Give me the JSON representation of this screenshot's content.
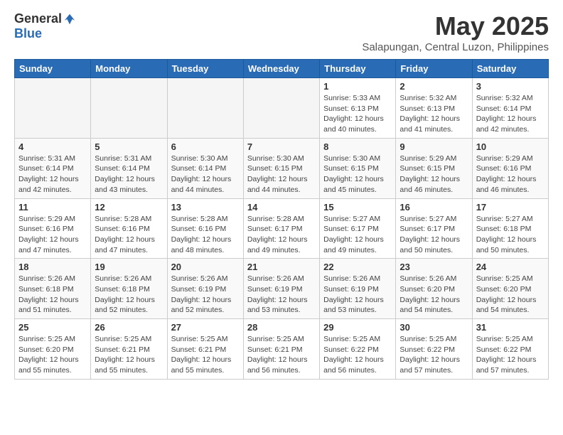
{
  "header": {
    "logo_general": "General",
    "logo_blue": "Blue",
    "title": "May 2025",
    "subtitle": "Salapungan, Central Luzon, Philippines"
  },
  "weekdays": [
    "Sunday",
    "Monday",
    "Tuesday",
    "Wednesday",
    "Thursday",
    "Friday",
    "Saturday"
  ],
  "weeks": [
    [
      {
        "day": "",
        "info": ""
      },
      {
        "day": "",
        "info": ""
      },
      {
        "day": "",
        "info": ""
      },
      {
        "day": "",
        "info": ""
      },
      {
        "day": "1",
        "info": "Sunrise: 5:33 AM\nSunset: 6:13 PM\nDaylight: 12 hours and 40 minutes."
      },
      {
        "day": "2",
        "info": "Sunrise: 5:32 AM\nSunset: 6:13 PM\nDaylight: 12 hours and 41 minutes."
      },
      {
        "day": "3",
        "info": "Sunrise: 5:32 AM\nSunset: 6:14 PM\nDaylight: 12 hours and 42 minutes."
      }
    ],
    [
      {
        "day": "4",
        "info": "Sunrise: 5:31 AM\nSunset: 6:14 PM\nDaylight: 12 hours and 42 minutes."
      },
      {
        "day": "5",
        "info": "Sunrise: 5:31 AM\nSunset: 6:14 PM\nDaylight: 12 hours and 43 minutes."
      },
      {
        "day": "6",
        "info": "Sunrise: 5:30 AM\nSunset: 6:14 PM\nDaylight: 12 hours and 44 minutes."
      },
      {
        "day": "7",
        "info": "Sunrise: 5:30 AM\nSunset: 6:15 PM\nDaylight: 12 hours and 44 minutes."
      },
      {
        "day": "8",
        "info": "Sunrise: 5:30 AM\nSunset: 6:15 PM\nDaylight: 12 hours and 45 minutes."
      },
      {
        "day": "9",
        "info": "Sunrise: 5:29 AM\nSunset: 6:15 PM\nDaylight: 12 hours and 46 minutes."
      },
      {
        "day": "10",
        "info": "Sunrise: 5:29 AM\nSunset: 6:16 PM\nDaylight: 12 hours and 46 minutes."
      }
    ],
    [
      {
        "day": "11",
        "info": "Sunrise: 5:29 AM\nSunset: 6:16 PM\nDaylight: 12 hours and 47 minutes."
      },
      {
        "day": "12",
        "info": "Sunrise: 5:28 AM\nSunset: 6:16 PM\nDaylight: 12 hours and 47 minutes."
      },
      {
        "day": "13",
        "info": "Sunrise: 5:28 AM\nSunset: 6:16 PM\nDaylight: 12 hours and 48 minutes."
      },
      {
        "day": "14",
        "info": "Sunrise: 5:28 AM\nSunset: 6:17 PM\nDaylight: 12 hours and 49 minutes."
      },
      {
        "day": "15",
        "info": "Sunrise: 5:27 AM\nSunset: 6:17 PM\nDaylight: 12 hours and 49 minutes."
      },
      {
        "day": "16",
        "info": "Sunrise: 5:27 AM\nSunset: 6:17 PM\nDaylight: 12 hours and 50 minutes."
      },
      {
        "day": "17",
        "info": "Sunrise: 5:27 AM\nSunset: 6:18 PM\nDaylight: 12 hours and 50 minutes."
      }
    ],
    [
      {
        "day": "18",
        "info": "Sunrise: 5:26 AM\nSunset: 6:18 PM\nDaylight: 12 hours and 51 minutes."
      },
      {
        "day": "19",
        "info": "Sunrise: 5:26 AM\nSunset: 6:18 PM\nDaylight: 12 hours and 52 minutes."
      },
      {
        "day": "20",
        "info": "Sunrise: 5:26 AM\nSunset: 6:19 PM\nDaylight: 12 hours and 52 minutes."
      },
      {
        "day": "21",
        "info": "Sunrise: 5:26 AM\nSunset: 6:19 PM\nDaylight: 12 hours and 53 minutes."
      },
      {
        "day": "22",
        "info": "Sunrise: 5:26 AM\nSunset: 6:19 PM\nDaylight: 12 hours and 53 minutes."
      },
      {
        "day": "23",
        "info": "Sunrise: 5:26 AM\nSunset: 6:20 PM\nDaylight: 12 hours and 54 minutes."
      },
      {
        "day": "24",
        "info": "Sunrise: 5:25 AM\nSunset: 6:20 PM\nDaylight: 12 hours and 54 minutes."
      }
    ],
    [
      {
        "day": "25",
        "info": "Sunrise: 5:25 AM\nSunset: 6:20 PM\nDaylight: 12 hours and 55 minutes."
      },
      {
        "day": "26",
        "info": "Sunrise: 5:25 AM\nSunset: 6:21 PM\nDaylight: 12 hours and 55 minutes."
      },
      {
        "day": "27",
        "info": "Sunrise: 5:25 AM\nSunset: 6:21 PM\nDaylight: 12 hours and 55 minutes."
      },
      {
        "day": "28",
        "info": "Sunrise: 5:25 AM\nSunset: 6:21 PM\nDaylight: 12 hours and 56 minutes."
      },
      {
        "day": "29",
        "info": "Sunrise: 5:25 AM\nSunset: 6:22 PM\nDaylight: 12 hours and 56 minutes."
      },
      {
        "day": "30",
        "info": "Sunrise: 5:25 AM\nSunset: 6:22 PM\nDaylight: 12 hours and 57 minutes."
      },
      {
        "day": "31",
        "info": "Sunrise: 5:25 AM\nSunset: 6:22 PM\nDaylight: 12 hours and 57 minutes."
      }
    ]
  ]
}
